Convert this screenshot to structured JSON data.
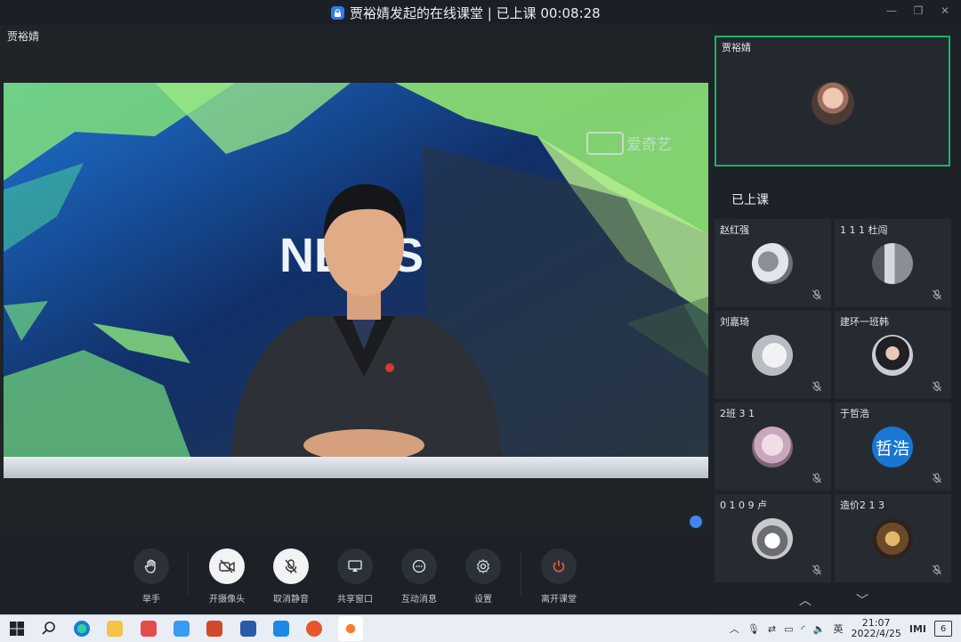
{
  "window": {
    "title": "贾裕婧发起的在线课堂 | 已上课 00:08:28"
  },
  "main": {
    "speaker_name": "贾裕婧",
    "overlay": {
      "news": "NEWS",
      "brand": "爱奇艺"
    }
  },
  "toolbar": {
    "buttons": [
      {
        "label": "举手",
        "icon": "raise-hand-icon"
      },
      {
        "label": "开摄像头",
        "icon": "camera-off-icon"
      },
      {
        "label": "取消静音",
        "icon": "mic-off-icon"
      },
      {
        "label": "共享窗口",
        "icon": "share-screen-icon"
      },
      {
        "label": "互动消息",
        "icon": "chat-icon"
      },
      {
        "label": "设置",
        "icon": "gear-icon"
      },
      {
        "label": "离开课堂",
        "icon": "power-icon"
      }
    ]
  },
  "panel": {
    "teacher": {
      "name": "贾裕婧"
    },
    "section_title": "已上课",
    "participants": [
      {
        "name": "赵红强"
      },
      {
        "name": "1 1 1 杜闯"
      },
      {
        "name": "刘嘉琦"
      },
      {
        "name": "建环一班韩"
      },
      {
        "name": "2班  3 1"
      },
      {
        "name": "于哲浩",
        "avatar_text": "哲浩"
      },
      {
        "name": "0 1 0 9 卢"
      },
      {
        "name": "造价2  1 3"
      }
    ]
  },
  "taskbar": {
    "tray": {
      "ime": "英",
      "time": "21:07",
      "date": "2022/4/25",
      "notify": "6"
    }
  },
  "colors": {
    "accent": "#2f7bf0",
    "active_border": "#20b066",
    "leave": "#ef5a3b"
  }
}
